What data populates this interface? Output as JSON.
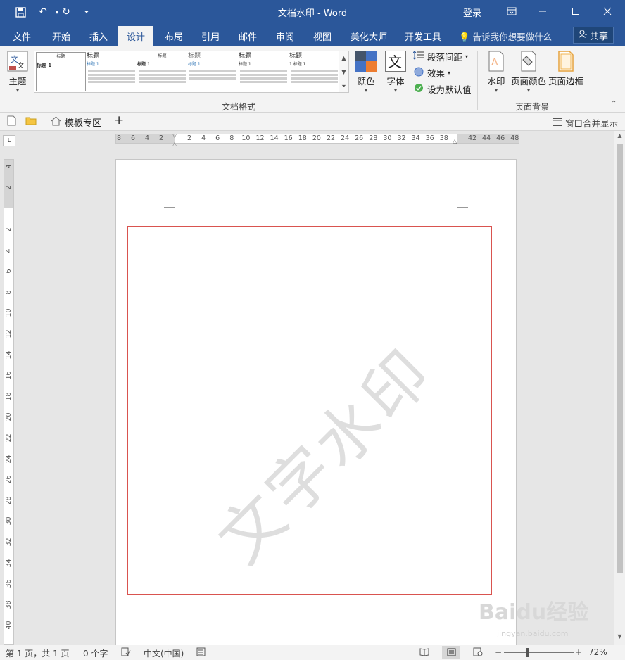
{
  "window": {
    "title": "文档水印  -  Word",
    "login": "登录",
    "share": "共享"
  },
  "tabs": [
    "文件",
    "开始",
    "插入",
    "设计",
    "布局",
    "引用",
    "邮件",
    "审阅",
    "视图",
    "美化大师",
    "开发工具"
  ],
  "active_tab": "设计",
  "tell_me": "告诉我你想要做什么",
  "ribbon": {
    "theme_label": "主题",
    "gallery_items": [
      {
        "heading": "标题",
        "sub": "标题 1"
      },
      {
        "heading": "标题",
        "sub": "标题 1"
      },
      {
        "heading": "标题",
        "sub": "标题 1"
      },
      {
        "heading": "标题",
        "sub": "标题 1"
      },
      {
        "heading": "标题",
        "sub": "标题 1"
      },
      {
        "heading": "标题",
        "sub": "1  标题 1"
      }
    ],
    "colors_label": "颜色",
    "fonts_label": "字体",
    "paragraph_spacing_label": "段落间距",
    "effects_label": "效果",
    "set_default_label": "设为默认值",
    "doc_format_group": "文档格式",
    "watermark_label": "水印",
    "page_color_label": "页面颜色",
    "page_border_label": "页面边框",
    "page_bg_group": "页面背景"
  },
  "docbar": {
    "template_zone": "模板专区",
    "add": "+",
    "merge_windows": "窗口合并显示"
  },
  "ruler": {
    "h_labels": [
      "8",
      "6",
      "4",
      "2",
      "2",
      "4",
      "6",
      "8",
      "10",
      "12",
      "14",
      "16",
      "18",
      "20",
      "22",
      "24",
      "26",
      "28",
      "30",
      "32",
      "34",
      "36",
      "38",
      "42",
      "44",
      "46",
      "48"
    ],
    "v_labels": [
      "4",
      "2",
      "2",
      "4",
      "6",
      "8",
      "10",
      "12",
      "14",
      "16",
      "18",
      "20",
      "22",
      "24",
      "26",
      "28",
      "30",
      "32",
      "34",
      "36",
      "38",
      "40"
    ]
  },
  "document": {
    "watermark_text": "文字水印"
  },
  "status": {
    "page": "第 1 页，共 1 页",
    "words": "0 个字",
    "language": "中文(中国)",
    "zoom": "72%"
  },
  "overlay": {
    "logo": "Baidu经验",
    "url": "jingyan.baidu.com"
  },
  "colors": {
    "brand": "#2b579a",
    "page_border": "#d9534f"
  }
}
